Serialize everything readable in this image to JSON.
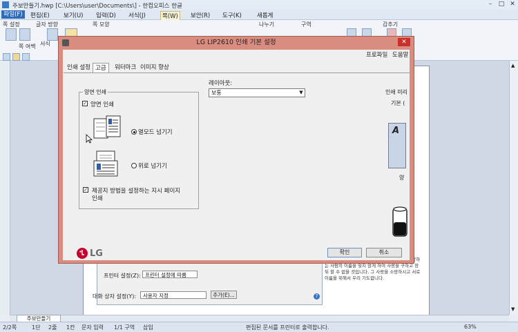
{
  "app": {
    "title": "주보만들기.hwp [C:\\Users\\user\\Documents\\] - 한컴오피스 한글",
    "menus": [
      "파일(F)",
      "편집(E)",
      "보기(U)",
      "입력(D)",
      "서식(J)",
      "쪽(W)",
      "보안(R)",
      "도구(K)",
      "새롭게"
    ],
    "ribbon_groups": [
      "쪽 설정",
      "글자 방향",
      "쪽 모양",
      "나누기",
      "구역",
      "감추기"
    ],
    "ribbon_items": [
      "서식",
      "쪽 여백"
    ],
    "document_tab": "주보만들기",
    "status": {
      "page": "2/2쪽",
      "line": "1단",
      "col": "2줄",
      "char": "1칸",
      "mode": "문자 입력",
      "section": "1/1 구역",
      "insert": "삽입",
      "message": "편집된 문서를 프린터로 출력합니다.",
      "zoom": "63%"
    },
    "page_text": "이름을 부르며 그리워 할 것 입니다. 어느 작 사랑하는 사람의 이름을 잊지 않게 하여 사랑을 구하고 장 뒤 할 수 없을 것입니다. 그 사랑을 소망하시고 서로 이름을 위해서 우리 기도합니다."
  },
  "under_dialog": {
    "printer_label": "프린터 설정(Z):",
    "printer_value": "프린터 설정에 따름",
    "quality_label": "대화 상자 설정(Y):",
    "quality_value": "사용자 지정",
    "more_button": "추가(E)...",
    "help_icon": "?"
  },
  "dialog": {
    "title": "LG LIP2610 인쇄 기본 설정",
    "close": "✕",
    "tabs": [
      "인쇄 설정",
      "고급",
      "워터마크",
      "이미지 향상"
    ],
    "active_tab": 1,
    "links": [
      "프로파일",
      "도움말"
    ],
    "duplex": {
      "group_title": "양면 인쇄",
      "enable_label": "양면 인쇄",
      "enable_checked": true,
      "long_edge_label": "열모드 넘기기",
      "short_edge_label": "위로 넘기기",
      "selected": "long",
      "skip_blank_label_1": "제공지 방법을 설정하는 지시 페이지",
      "skip_blank_label_2": "인쇄",
      "skip_blank_checked": true
    },
    "layout": {
      "label": "레이아웃:",
      "value": "보통"
    },
    "preview": {
      "label": "인쇄 미리",
      "sub": "기본 (",
      "mid": "양"
    },
    "buttons": {
      "ok": "확인",
      "cancel": "취소"
    },
    "logo": "LG"
  }
}
